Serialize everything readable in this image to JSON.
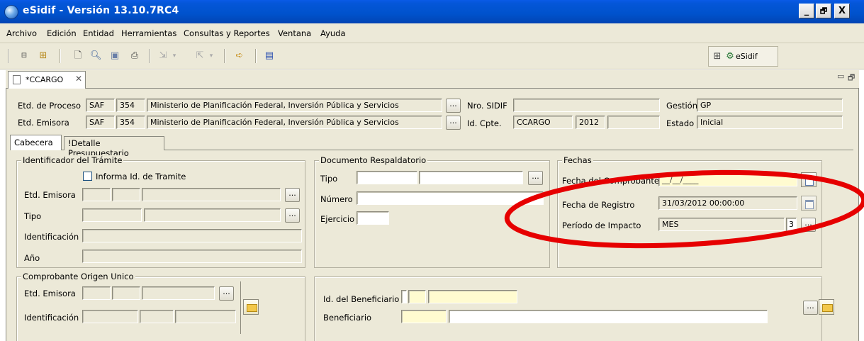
{
  "window": {
    "title": "eSidif - Versión 13.10.7RC4",
    "minimize": "_",
    "restore": "🗗",
    "close": "X"
  },
  "menu": [
    "Archivo",
    "Edición",
    "Entidad",
    "Herramientas",
    "Consultas y Reportes",
    "Ventana",
    "Ayuda"
  ],
  "toolbar": {
    "perspective_label": "eSidif"
  },
  "editor_tab": {
    "label": "*CCARGO",
    "close": "✕"
  },
  "header": {
    "etd_proceso": {
      "label": "Etd. de Proceso",
      "tipo": "SAF",
      "codigo": "354",
      "nombre": "Ministerio de Planificación Federal, Inversión Pública y Servicios"
    },
    "etd_emisora": {
      "label": "Etd. Emisora",
      "tipo": "SAF",
      "codigo": "354",
      "nombre": "Ministerio de Planificación Federal, Inversión Pública y Servicios"
    },
    "nro_sidif": {
      "label": "Nro. SIDIF",
      "value": ""
    },
    "id_cpte": {
      "label": "Id. Cpte.",
      "tipo": "CCARGO",
      "anio": "2012",
      "numero": ""
    },
    "gestion": {
      "label": "Gestión",
      "value": "GP"
    },
    "estado": {
      "label": "Estado",
      "value": "Inicial"
    },
    "ellipsis": "..."
  },
  "tabs": [
    "Cabecera",
    "!Detalle Presupuestario"
  ],
  "identificador": {
    "title": "Identificador del Trámite",
    "checkbox_label": "Informa Id. de Tramite",
    "etd_emisora": "Etd. Emisora",
    "tipo": "Tipo",
    "identificacion": "Identificación",
    "anio": "Año"
  },
  "documento": {
    "title": "Documento Respaldatorio",
    "tipo": "Tipo",
    "numero": "Número",
    "ejercicio": "Ejercicio"
  },
  "fechas": {
    "title": "Fechas",
    "fecha_comprobante_label": "Fecha del Comprobante",
    "fecha_comprobante_value": "__/__/____",
    "fecha_registro_label": "Fecha de Registro",
    "fecha_registro_value": "31/03/2012 00:00:00",
    "periodo_label": "Período de Impacto",
    "periodo_value": "MES",
    "periodo_num": "3"
  },
  "comprobante_origen": {
    "title": "Comprobante Origen Unico",
    "etd_emisora": "Etd. Emisora",
    "identificacion": "Identificación"
  },
  "beneficiario": {
    "id_label": "Id. del Beneficiario",
    "label": "Beneficiario"
  },
  "colors": {
    "title_blue": "#0052cc",
    "panel": "#ece9d8",
    "required_yellow": "#fffbd0",
    "annotation_red": "#e60000"
  }
}
